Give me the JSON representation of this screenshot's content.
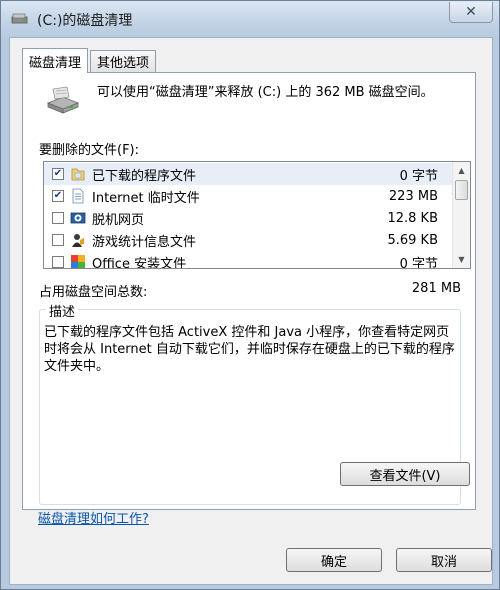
{
  "window": {
    "title": "(C:)的磁盘清理",
    "close_glyph": "✕"
  },
  "tabs": [
    {
      "label": "磁盘清理",
      "active": true
    },
    {
      "label": "其他选项",
      "active": false
    }
  ],
  "info": {
    "text": "可以使用“磁盘清理”来释放 (C:) 上的 362 MB 磁盘空间。",
    "icon": "disk-cleanup-icon"
  },
  "files_section": {
    "label": "要删除的文件(F):"
  },
  "file_list": [
    {
      "checked": true,
      "icon": "folder-icon",
      "name": "已下载的程序文件",
      "size": "0 字节"
    },
    {
      "checked": true,
      "icon": "document-icon",
      "name": "Internet 临时文件",
      "size": "223 MB"
    },
    {
      "checked": false,
      "icon": "offline-web-icon",
      "name": "脱机网页",
      "size": "12.8 KB"
    },
    {
      "checked": false,
      "icon": "game-stats-icon",
      "name": "游戏统计信息文件",
      "size": "5.69 KB"
    },
    {
      "checked": false,
      "icon": "office-setup-icon",
      "name": "Office 安装文件",
      "size": "0 字节"
    }
  ],
  "total": {
    "label": "占用磁盘空间总数:",
    "value": "281 MB"
  },
  "description": {
    "title": "描述",
    "text": "已下载的程序文件包括 ActiveX 控件和 Java 小程序，你查看特定网页时将会从 Internet 自动下载它们，并临时保存在硬盘上的已下载的程序文件夹中。",
    "view_files_label": "查看文件(V)"
  },
  "help_link": "磁盘清理如何工作?",
  "buttons": {
    "ok": "确定",
    "cancel": "取消"
  },
  "colors": {
    "link": "#0a54b0",
    "selected_row": "#e8eef8"
  }
}
